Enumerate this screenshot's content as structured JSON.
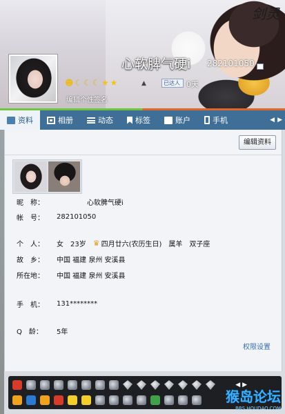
{
  "header": {
    "nickname": "心软脾气硬i",
    "qq_number": "282101050",
    "sign_prompt": "编辑个性签名",
    "days_badge": "已达人",
    "days_value": "0天",
    "levels": [
      "sun",
      "moon",
      "moon",
      "moon",
      "star",
      "star"
    ],
    "calligraphy": "剑灵"
  },
  "tabs": [
    {
      "label": "资料",
      "icon": "profile-card-icon",
      "active": true
    },
    {
      "label": "相册",
      "icon": "photo-icon",
      "active": false
    },
    {
      "label": "动态",
      "icon": "list-icon",
      "active": false
    },
    {
      "label": "标签",
      "icon": "tag-icon",
      "active": false
    },
    {
      "label": "账户",
      "icon": "wallet-icon",
      "active": false
    },
    {
      "label": "手机",
      "icon": "phone-icon",
      "active": false
    }
  ],
  "panel": {
    "edit_button": "编辑资料",
    "rows": [
      {
        "label": "昵　称：",
        "value": "心软脾气硬i"
      },
      {
        "label": "帐　号：",
        "value": "282101050"
      },
      {
        "label": "个　人：",
        "value": [
          "女",
          "23岁",
          "四月廿六(农历生日)",
          "属羊",
          "双子座"
        ]
      },
      {
        "label": "故　乡：",
        "value": "中国 福建 泉州 安溪县"
      },
      {
        "label": "所在地：",
        "value": "中国 福建 泉州 安溪县"
      },
      {
        "label": "手　机：",
        "value": "131********"
      },
      {
        "label": "Q　龄：",
        "value": "5年"
      }
    ],
    "permission_link": "权限设置"
  },
  "watermark": {
    "title": "猴岛论坛",
    "site": "BBS.HOUDAO.COM"
  },
  "colors": {
    "tab_bar": "#3f6f96",
    "link": "#3a6fb3",
    "panel_bg": "#f2f4f7"
  }
}
